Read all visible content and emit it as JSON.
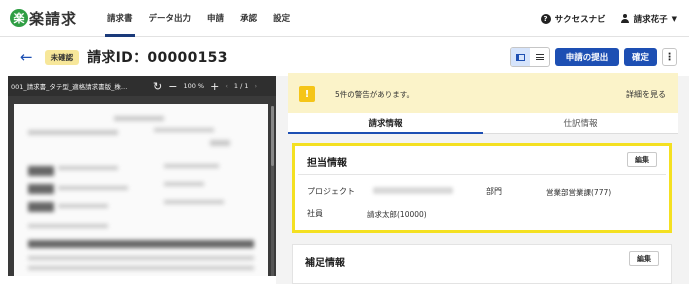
{
  "app": {
    "logo_glyph": "楽",
    "logo_text": "楽請求"
  },
  "nav": {
    "links": [
      "請求書",
      "データ出力",
      "申請",
      "承認",
      "設定"
    ],
    "active_index": 0,
    "help_label": "サクセスナビ",
    "user_name": "請求花子",
    "help_icon": "question-circle-icon",
    "user_icon": "person-icon"
  },
  "titlebar": {
    "status_badge": "未確認",
    "title": "請求ID：00000153",
    "submit_label": "申請の提出",
    "confirm_label": "確定",
    "more_label": "⋮",
    "view_modes": [
      "split-view-icon",
      "list-view-icon"
    ],
    "active_view": "split-view-icon"
  },
  "viewer": {
    "file_name": "001_請求書_タテ型_適格請求書版_株…",
    "zoom": "100 %",
    "page_indicator": "1 / 1"
  },
  "warning": {
    "message": "5件の警告があります。",
    "link": "詳細を見る",
    "color": "#f5c518"
  },
  "tabs": [
    "請求情報",
    "仕訳情報"
  ],
  "active_tab": 0,
  "sections": {
    "tanto": {
      "title": "担当情報",
      "edit_label": "編集",
      "project_label": "プロジェクト",
      "dept_label": "部門",
      "dept_value": "営業部営業課(777)",
      "employee_label": "社員",
      "employee_value": "請求太郎(10000)"
    },
    "hosoku": {
      "title": "補足情報",
      "edit_label": "編集"
    }
  },
  "colors": {
    "primary": "#1d4fb3",
    "highlight": "#f4e021",
    "badge": "#f7e79a",
    "warning_bg": "#fbf3c9"
  }
}
